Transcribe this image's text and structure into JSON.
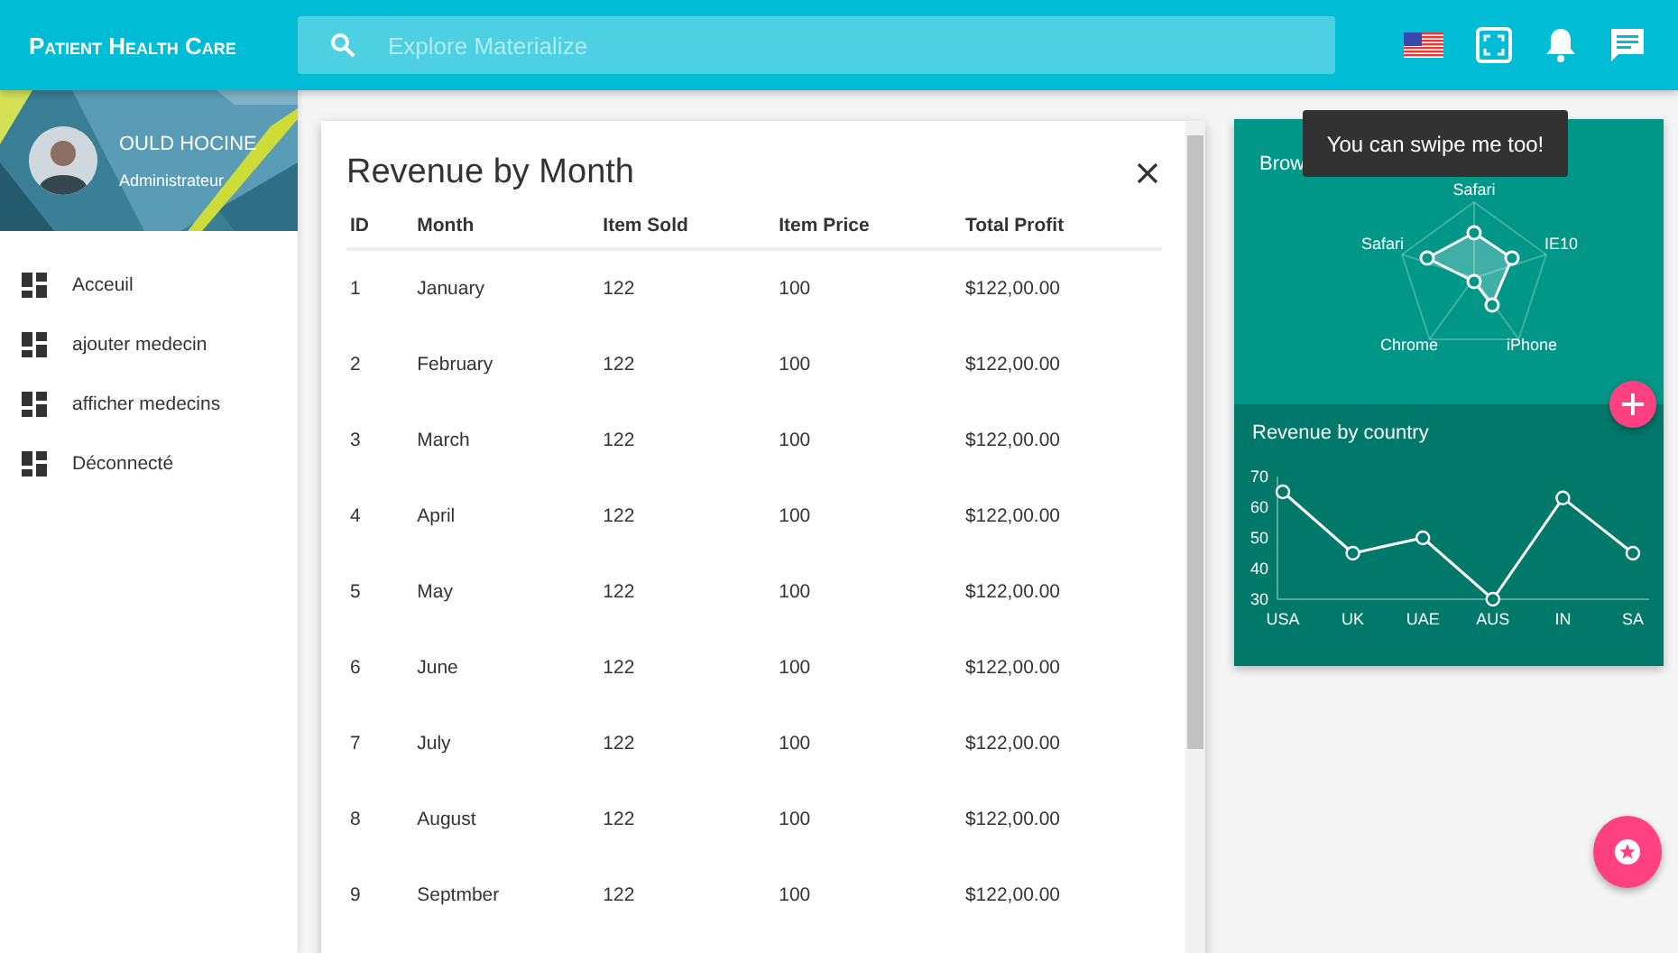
{
  "app": {
    "title": "Patient Health Care"
  },
  "search": {
    "placeholder": "Explore Materialize"
  },
  "profile": {
    "name": "OULD HOCINE",
    "role": "Administrateur"
  },
  "sidebar": {
    "items": [
      {
        "label": "Acceuil"
      },
      {
        "label": "ajouter medecin"
      },
      {
        "label": "afficher medecins"
      },
      {
        "label": "Déconnecté"
      }
    ]
  },
  "modal": {
    "title": "Revenue by Month",
    "table": {
      "columns": [
        "ID",
        "Month",
        "Item Sold",
        "Item Price",
        "Total Profit"
      ],
      "rows": [
        [
          "1",
          "January",
          "122",
          "100",
          "$122,00.00"
        ],
        [
          "2",
          "February",
          "122",
          "100",
          "$122,00.00"
        ],
        [
          "3",
          "March",
          "122",
          "100",
          "$122,00.00"
        ],
        [
          "4",
          "April",
          "122",
          "100",
          "$122,00.00"
        ],
        [
          "5",
          "May",
          "122",
          "100",
          "$122,00.00"
        ],
        [
          "6",
          "June",
          "122",
          "100",
          "$122,00.00"
        ],
        [
          "7",
          "July",
          "122",
          "100",
          "$122,00.00"
        ],
        [
          "8",
          "August",
          "122",
          "100",
          "$122,00.00"
        ],
        [
          "9",
          "Septmber",
          "122",
          "100",
          "$122,00.00"
        ]
      ]
    }
  },
  "browser_card": {
    "title": "Brow",
    "labels": [
      "Safari",
      "IE10",
      "iPhone",
      "Chrome",
      "Safari"
    ]
  },
  "tooltip": {
    "text": "You can swipe me too!"
  },
  "country_card": {
    "title": "Revenue by country",
    "chart_data": {
      "type": "line",
      "categories": [
        "USA",
        "UK",
        "UAE",
        "AUS",
        "IN",
        "SA"
      ],
      "series": [
        {
          "color": "#ffffff",
          "marker": "circle",
          "values": [
            65,
            45,
            50,
            30,
            63,
            45
          ]
        }
      ],
      "ylim": [
        30,
        70
      ],
      "yticks": [
        30,
        40,
        50,
        60,
        70
      ]
    }
  }
}
